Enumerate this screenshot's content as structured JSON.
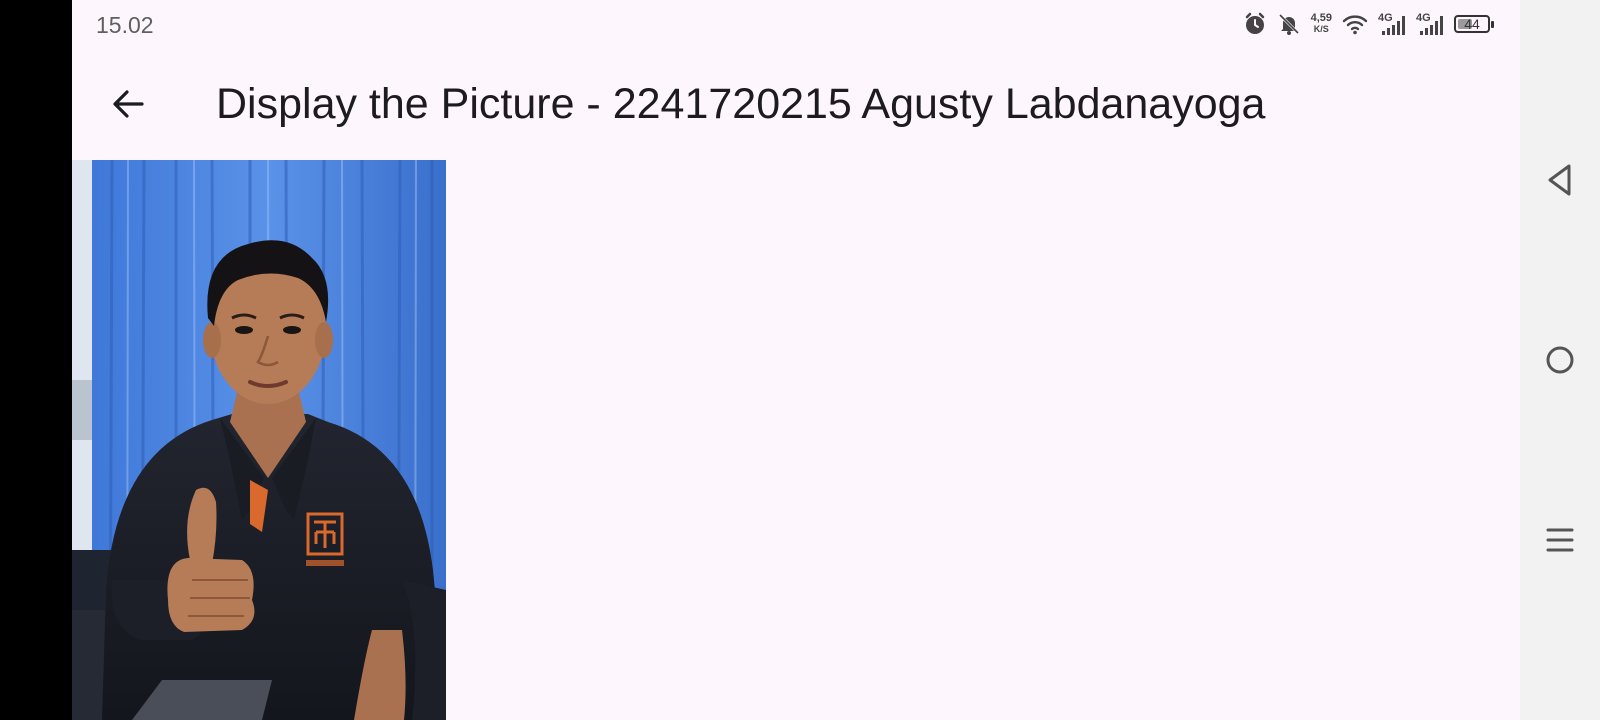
{
  "status_bar": {
    "time": "15.02",
    "speed_value": "4,59",
    "speed_unit": "K/S",
    "network_1": "4G",
    "network_2": "4G",
    "battery_level": "44"
  },
  "app_bar": {
    "title": "Display the Picture - 2241720215 Agusty Labdanayoga"
  },
  "colors": {
    "background": "#fdf7fd",
    "title_text": "#1d1b20",
    "nav_bar": "#f2f2f2"
  },
  "icons": {
    "back": "arrow-back-icon",
    "alarm": "alarm-icon",
    "mute": "notifications-off-icon",
    "wifi": "wifi-icon",
    "signal": "signal-icon",
    "battery": "battery-icon",
    "nav_back": "triangle-back-icon",
    "nav_home": "circle-home-icon",
    "nav_recents": "menu-recents-icon"
  }
}
